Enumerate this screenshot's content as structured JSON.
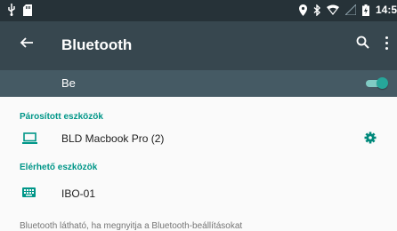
{
  "status_bar": {
    "time": "14:5",
    "icons": [
      "usb-icon",
      "sd-card-icon",
      "location-icon",
      "bluetooth-icon",
      "wifi-icon",
      "signal-icon",
      "battery-icon"
    ]
  },
  "toolbar": {
    "title": "Bluetooth",
    "icons": [
      "back-arrow-icon",
      "search-icon",
      "more-vert-icon"
    ]
  },
  "master": {
    "label": "Be",
    "enabled": true
  },
  "paired": {
    "header": "Párosított eszközök",
    "devices": [
      {
        "name": "BLD Macbook Pro (2)",
        "icon": "laptop-icon",
        "settings_icon": "gear-icon"
      }
    ]
  },
  "available": {
    "header": "Elérhető eszközök",
    "devices": [
      {
        "name": "IBO-01",
        "icon": "keyboard-icon"
      }
    ]
  },
  "footer": {
    "text": "Bluetooth látható, ha megnyitja a Bluetooth-beállításokat"
  },
  "colors": {
    "status_bar": "#263238",
    "toolbar": "#37474f",
    "master_bar": "#455a64",
    "accent": "#009688",
    "background": "#fafafa"
  }
}
